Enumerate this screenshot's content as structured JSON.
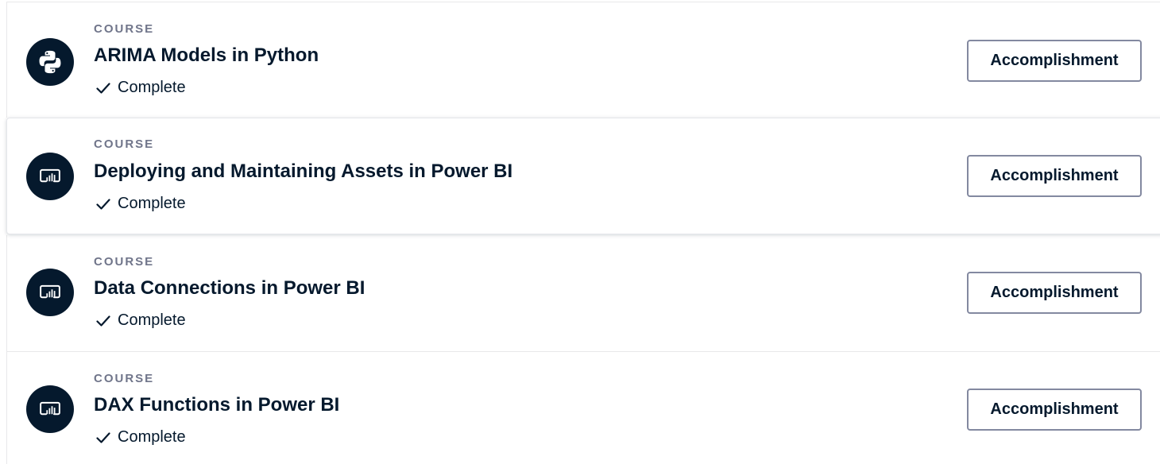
{
  "courses": [
    {
      "type_label": "COURSE",
      "title": "ARIMA Models in Python",
      "status": "Complete",
      "button_label": "Accomplishment",
      "icon": "python-icon"
    },
    {
      "type_label": "COURSE",
      "title": "Deploying and Maintaining Assets in Power BI",
      "status": "Complete",
      "button_label": "Accomplishment",
      "icon": "power-bi-icon"
    },
    {
      "type_label": "COURSE",
      "title": "Data Connections in Power BI",
      "status": "Complete",
      "button_label": "Accomplishment",
      "icon": "power-bi-icon"
    },
    {
      "type_label": "COURSE",
      "title": "DAX Functions in Power BI",
      "status": "Complete",
      "button_label": "Accomplishment",
      "icon": "power-bi-icon"
    }
  ],
  "colors": {
    "navy": "#05192d",
    "label_gray": "#70758a",
    "button_border": "#8389a0"
  }
}
